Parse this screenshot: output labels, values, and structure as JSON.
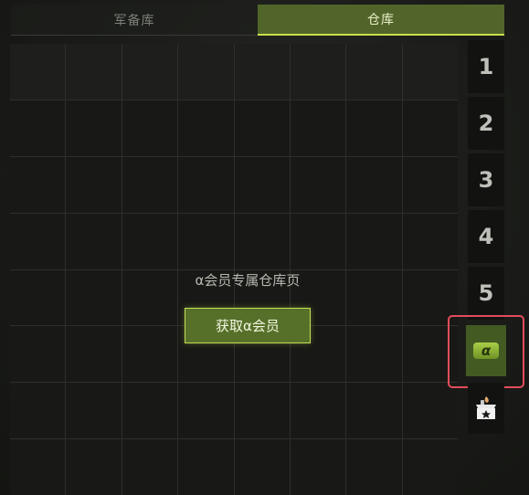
{
  "tabs": [
    {
      "label": "军备库",
      "active": false
    },
    {
      "label": "仓库",
      "active": true
    }
  ],
  "storage": {
    "locked_message": "α会员专属仓库页",
    "get_button_label": "获取α会员"
  },
  "pages": [
    "1",
    "2",
    "3",
    "4",
    "5"
  ],
  "alpha_page": {
    "icon": "alpha-membership-icon",
    "glyph": "α"
  },
  "shop_page": {
    "icon": "shop-basket-icon"
  },
  "colors": {
    "accent": "#c7e04b",
    "active_tab_bg": "#51652a",
    "highlight_border": "#e24c5c"
  }
}
